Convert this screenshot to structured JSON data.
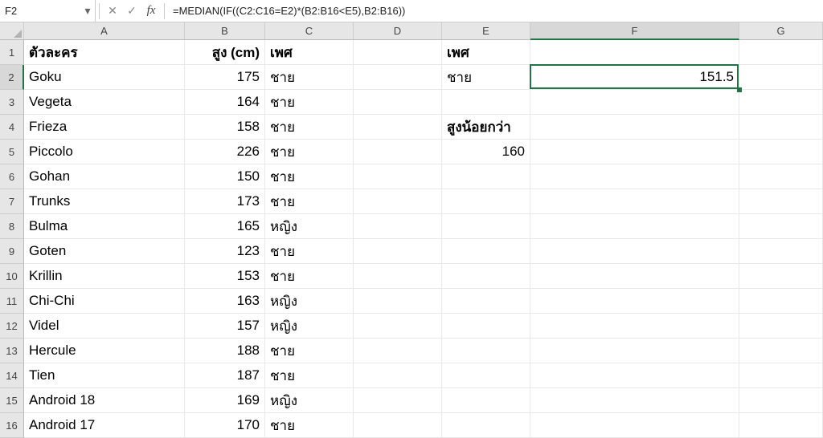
{
  "name_box": {
    "value": "F2"
  },
  "formula": "=MEDIAN(IF((C2:C16=E2)*(B2:B16<E5),B2:B16))",
  "columns": [
    "A",
    "B",
    "C",
    "D",
    "E",
    "F",
    "G"
  ],
  "selected_col": "F",
  "selected_row": 2,
  "headers": {
    "col_a": "ตัวละคร",
    "col_b": "สูง (cm)",
    "col_c": "เพศ",
    "col_e": "เพศ",
    "e2": "ชาย",
    "e4": "สูงน้อยกว่า",
    "e5": "160",
    "f2": "151.5"
  },
  "rows": [
    {
      "a": "Goku",
      "b": "175",
      "c": "ชาย"
    },
    {
      "a": "Vegeta",
      "b": "164",
      "c": "ชาย"
    },
    {
      "a": "Frieza",
      "b": "158",
      "c": "ชาย"
    },
    {
      "a": "Piccolo",
      "b": "226",
      "c": "ชาย"
    },
    {
      "a": "Gohan",
      "b": "150",
      "c": "ชาย"
    },
    {
      "a": "Trunks",
      "b": "173",
      "c": "ชาย"
    },
    {
      "a": "Bulma",
      "b": "165",
      "c": "หญิง"
    },
    {
      "a": "Goten",
      "b": "123",
      "c": "ชาย"
    },
    {
      "a": "Krillin",
      "b": "153",
      "c": "ชาย"
    },
    {
      "a": "Chi-Chi",
      "b": "163",
      "c": "หญิง"
    },
    {
      "a": "Videl",
      "b": "157",
      "c": "หญิง"
    },
    {
      "a": "Hercule",
      "b": "188",
      "c": "ชาย"
    },
    {
      "a": "Tien",
      "b": "187",
      "c": "ชาย"
    },
    {
      "a": "Android 18",
      "b": "169",
      "c": "หญิง"
    },
    {
      "a": "Android 17",
      "b": "170",
      "c": "ชาย"
    }
  ],
  "icons": {
    "caret": "▾",
    "cancel": "✕",
    "accept": "✓",
    "fx": "fx"
  }
}
